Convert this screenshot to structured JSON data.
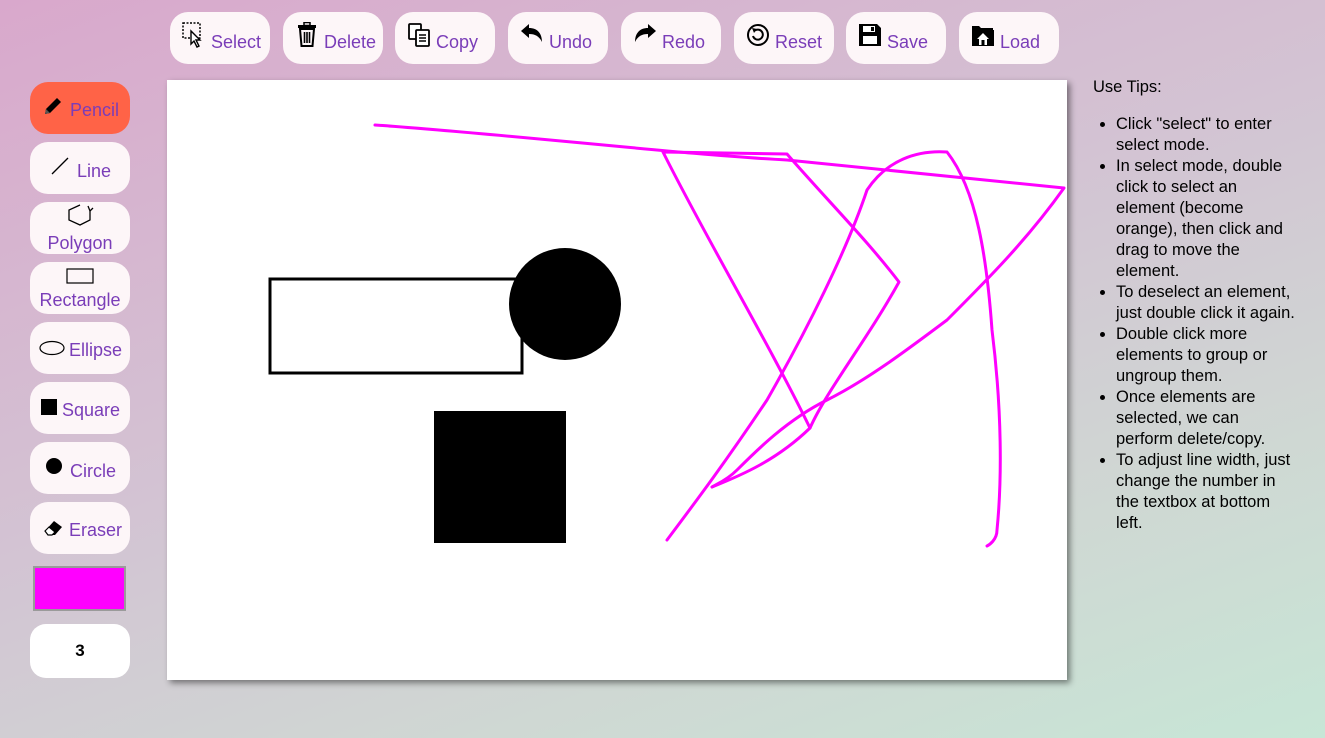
{
  "toolbar": {
    "select": "Select",
    "delete": "Delete",
    "copy": "Copy",
    "undo": "Undo",
    "redo": "Redo",
    "reset": "Reset",
    "save": "Save",
    "load": "Load"
  },
  "tools": {
    "pencil": "Pencil",
    "line": "Line",
    "polygon": "Polygon",
    "rectangle": "Rectangle",
    "ellipse": "Ellipse",
    "square": "Square",
    "circle": "Circle",
    "eraser": "Eraser",
    "active": "pencil"
  },
  "stroke": {
    "color": "#ff00ff",
    "width": "3"
  },
  "colors": {
    "accent_text": "#7a3db8",
    "active_tool": "#ff6347",
    "drawing_stroke": "#ff00ff"
  },
  "tips": {
    "title": "Use Tips:",
    "items": [
      "Click \"select\" to enter select mode.",
      "In select mode, double click to select an element (become orange), then click and drag to move the element.",
      "To deselect an element, just double click it again.",
      "Double click more elements to group or ungroup them.",
      "Once elements are selected, we can perform delete/copy.",
      "To adjust line width, just change the number in the textbox at bottom left."
    ]
  }
}
